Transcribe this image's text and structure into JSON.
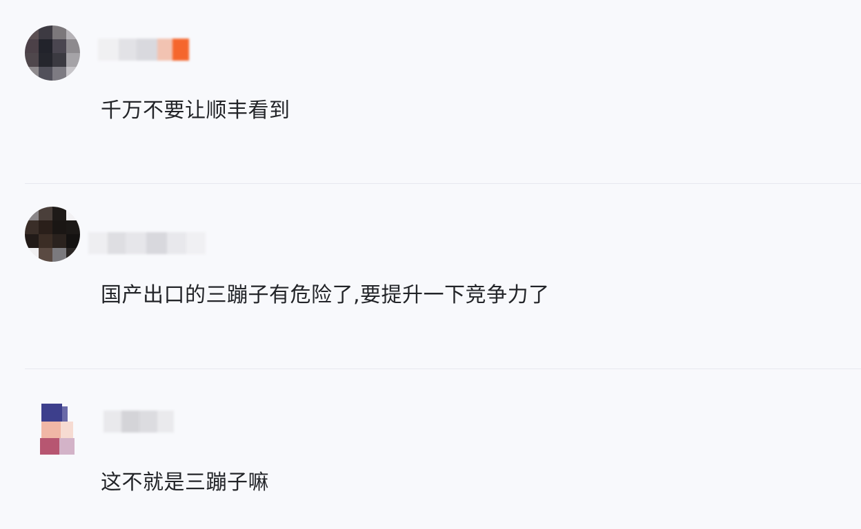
{
  "comments": [
    {
      "avatar_icon": "user-avatar-icon",
      "text": "千万不要让顺丰看到"
    },
    {
      "avatar_icon": "user-avatar-icon",
      "text": "国产出口的三蹦子有危险了,要提升一下竞争力了"
    },
    {
      "avatar_icon": "user-avatar-icon",
      "text": "这不就是三蹦子嘛"
    }
  ],
  "colors": {
    "background": "#f8f9fc",
    "text": "#222428",
    "divider": "#e6e8ee"
  }
}
